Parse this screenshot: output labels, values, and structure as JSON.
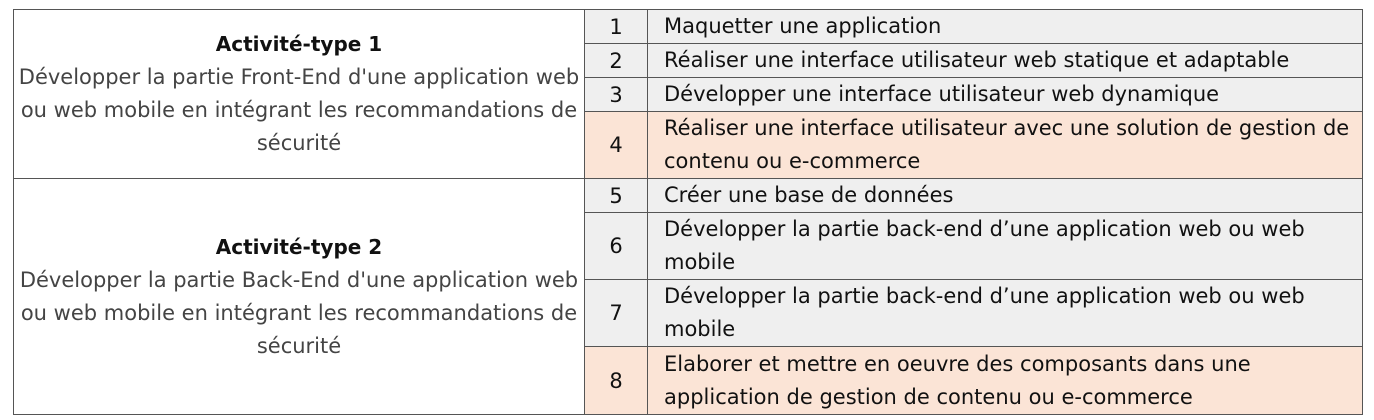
{
  "activities": [
    {
      "title": "Activité-type 1",
      "description": "Développer la partie Front-End d'une application web ou web mobile en intégrant les recommandations de sécurité",
      "skills": [
        {
          "num": "1",
          "label": "Maquetter une application"
        },
        {
          "num": "2",
          "label": "Réaliser une interface utilisateur web statique et adaptable"
        },
        {
          "num": "3",
          "label": "Développer une interface utilisateur web dynamique"
        },
        {
          "num": "4",
          "label": "Réaliser une interface utilisateur avec une solution de gestion de contenu ou e-commerce"
        }
      ]
    },
    {
      "title": "Activité-type 2",
      "description": "Développer la partie Back-End d'une application web ou web mobile en intégrant les recommandations de sécurité",
      "skills": [
        {
          "num": "5",
          "label": "Créer une base de données"
        },
        {
          "num": "6",
          "label": "Développer la partie back-end d’une application web ou web mobile"
        },
        {
          "num": "7",
          "label": "Développer la partie back-end d’une application web ou web mobile"
        },
        {
          "num": "8",
          "label": "Elaborer et mettre en oeuvre des composants dans une application de gestion de contenu ou e-commerce"
        }
      ]
    }
  ],
  "colors": {
    "row_grey": "#efefef",
    "row_peach": "#fbe4d6",
    "border": "#555555"
  }
}
